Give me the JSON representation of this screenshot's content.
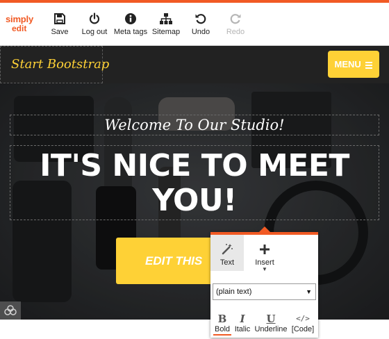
{
  "editor": {
    "logo_line1": "simply",
    "logo_line2": "edit",
    "accent_color": "#f15a24",
    "tools": [
      {
        "label": "Save",
        "icon": "save-icon"
      },
      {
        "label": "Log out",
        "icon": "power-icon"
      },
      {
        "label": "Meta tags",
        "icon": "info-icon"
      },
      {
        "label": "Sitemap",
        "icon": "sitemap-icon"
      },
      {
        "label": "Undo",
        "icon": "undo-icon"
      },
      {
        "label": "Redo",
        "icon": "redo-icon",
        "disabled": true
      }
    ]
  },
  "site": {
    "brand": "Start Bootstrap",
    "menu_label": "MENU",
    "brand_color": "#fed136",
    "hero": {
      "lead": "Welcome To Our Studio!",
      "heading_line1": "IT'S NICE TO MEET",
      "heading_line2": "YOU!",
      "cta_label": "EDIT THIS"
    }
  },
  "popover": {
    "tabs": [
      {
        "label": "Text",
        "icon": "magic-wand-icon"
      },
      {
        "label": "Insert",
        "icon": "plus-icon"
      }
    ],
    "format_select": "(plain text)",
    "format_buttons": [
      {
        "glyph": "B",
        "label": "Bold"
      },
      {
        "glyph": "I",
        "label": "Italic"
      },
      {
        "glyph": "U",
        "label": "Underline"
      },
      {
        "glyph": "</>",
        "label": "[Code]"
      }
    ]
  }
}
